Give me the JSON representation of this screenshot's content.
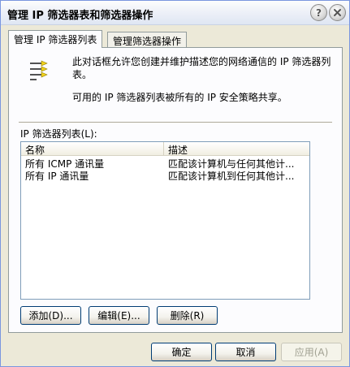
{
  "window": {
    "title": "管理 IP 筛选器表和筛选器操作",
    "help_label": "?"
  },
  "tabs": [
    {
      "label": "管理 IP 筛选器列表",
      "active": true
    },
    {
      "label": "管理筛选器操作",
      "active": false
    }
  ],
  "panel": {
    "description_1": "此对话框允许您创建并维护描述您的网络通信的 IP 筛选器列表。",
    "description_2": "可用的 IP 筛选器列表被所有的 IP 安全策略共享。",
    "list_label": "IP 筛选器列表(L):",
    "list": {
      "columns": [
        "名称",
        "描述"
      ],
      "rows": [
        {
          "name": "所有 ICMP 通讯量",
          "description": "匹配该计算机与任何其他计..."
        },
        {
          "name": "所有 IP 通讯量",
          "description": "匹配该计算机到任何其他计..."
        }
      ]
    },
    "buttons": {
      "add": "添加(D)...",
      "edit": "编辑(E)...",
      "remove": "删除(R)"
    }
  },
  "footer": {
    "ok": "确定",
    "cancel": "取消",
    "apply": "应用(A)"
  },
  "colors": {
    "window_bg": "#ece9d8",
    "panel_bg": "#fcfcfe",
    "border": "#7a96df"
  }
}
